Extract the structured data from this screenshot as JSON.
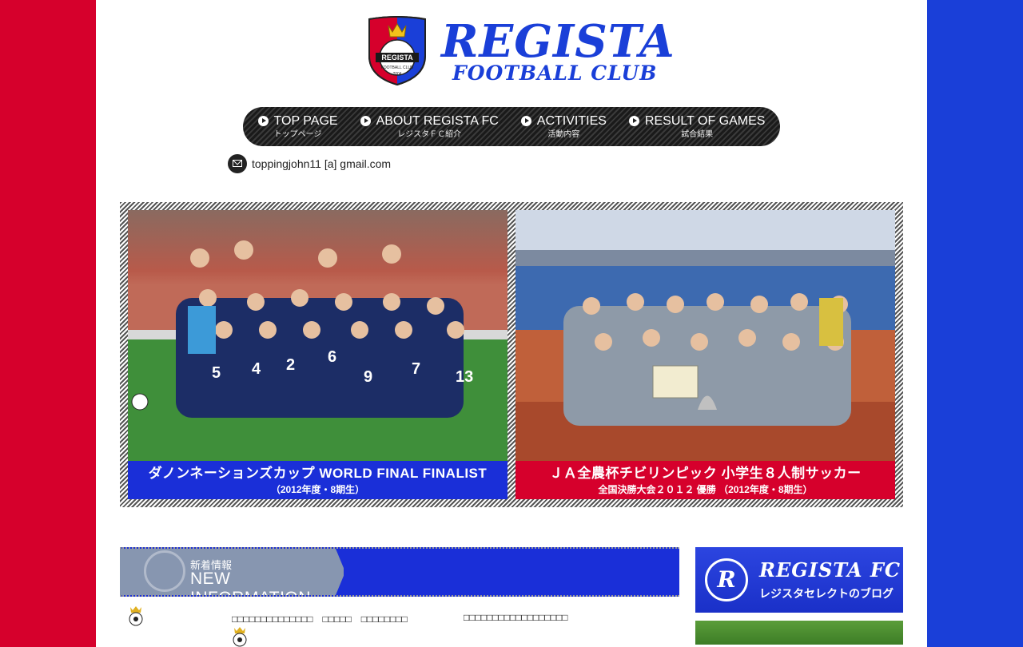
{
  "logo": {
    "main": "REGISTA",
    "sub": "FOOTBALL CLUB",
    "crest_text": "REGISTA",
    "crest_sub": "FOOTBALL CLUB",
    "crest_year": "2004"
  },
  "nav": [
    {
      "label": "TOP PAGE",
      "sub": "トップページ"
    },
    {
      "label": "ABOUT REGISTA FC",
      "sub": "レジスタＦＣ紹介"
    },
    {
      "label": "ACTIVITIES",
      "sub": "活動内容"
    },
    {
      "label": "RESULT OF GAMES",
      "sub": "試合結果"
    }
  ],
  "contact": {
    "email": "toppingjohn11 [a] gmail.com",
    "icon": "mail-icon"
  },
  "hero": [
    {
      "caption": "ダノンネーションズカップ WORLD FINAL FINALIST",
      "sub": "（2012年度・8期生）",
      "band_color": "#1a2fd8"
    },
    {
      "caption": "ＪＡ全農杯チビリンピック 小学生８人制サッカー",
      "sub": "全国決勝大会２０１２ 優勝 （2012年度・8期生）",
      "band_color": "#d6002c"
    }
  ],
  "news": {
    "title_jp": "新着情報",
    "title_en": "NEW INFORMATION",
    "row_text_1": "□□□□□□□□□□□□□□　□□□□□　□□□□□□□□",
    "row_text_2": "□□□□□□□□□□□□□□□□□□"
  },
  "sidebar": {
    "blog_title": "REGISTA FC",
    "blog_sub": "レジスタセレクトのブログ",
    "blog_logo": "R"
  },
  "colors": {
    "red": "#d6002c",
    "blue": "#1a3fd8"
  }
}
